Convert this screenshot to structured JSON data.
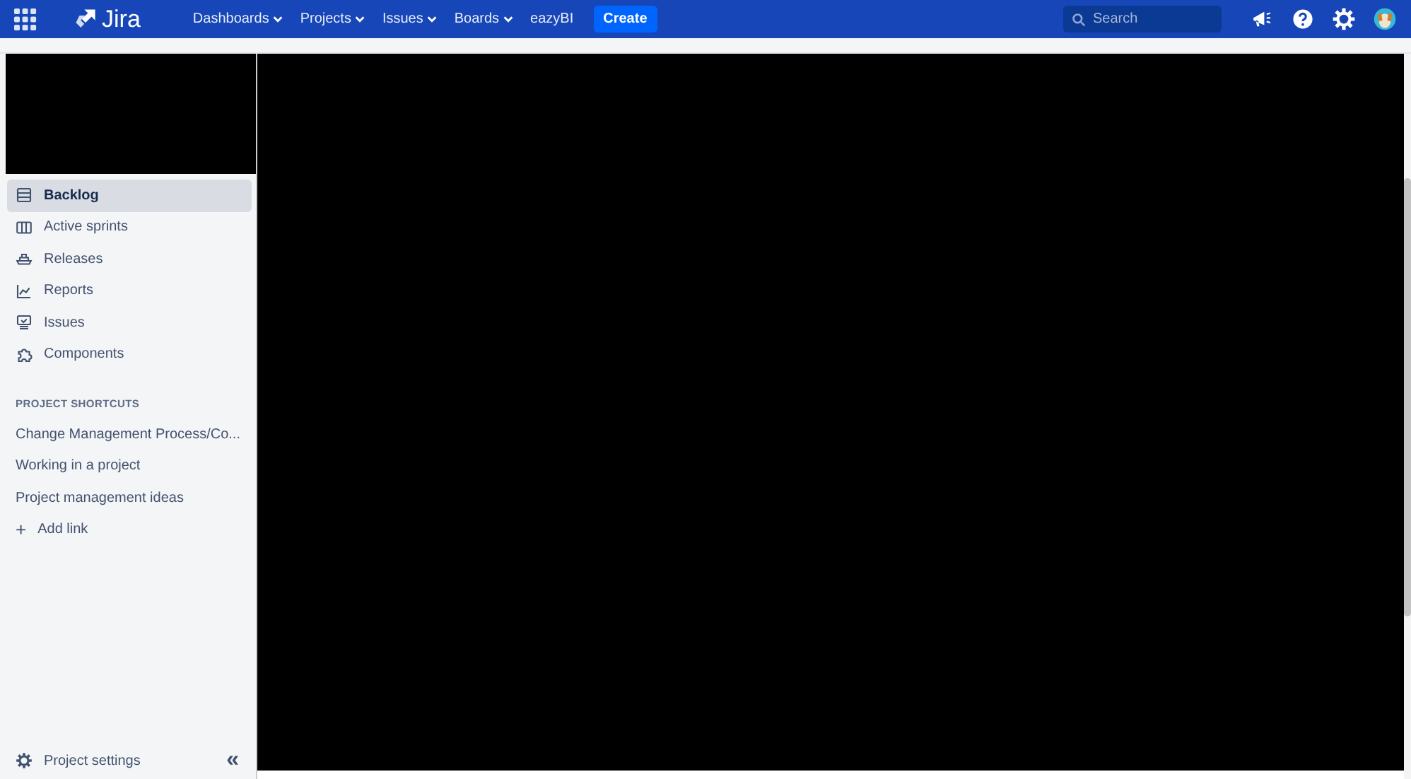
{
  "header": {
    "logo": "Jira",
    "nav": [
      {
        "label": "Dashboards",
        "dropdown": true
      },
      {
        "label": "Projects",
        "dropdown": true
      },
      {
        "label": "Issues",
        "dropdown": true
      },
      {
        "label": "Boards",
        "dropdown": true
      },
      {
        "label": "eazyBI",
        "dropdown": false
      }
    ],
    "create": "Create",
    "search": {
      "placeholder": "Search"
    }
  },
  "sidebar": {
    "items": [
      {
        "label": "Backlog",
        "kind": "backlog",
        "selected": true
      },
      {
        "label": "Active sprints",
        "kind": "board",
        "selected": false
      },
      {
        "label": "Releases",
        "kind": "ship",
        "selected": false
      },
      {
        "label": "Reports",
        "kind": "chart",
        "selected": false
      },
      {
        "label": "Issues",
        "kind": "issues",
        "selected": false
      },
      {
        "label": "Components",
        "kind": "puzzle",
        "selected": false
      }
    ],
    "shortcuts_heading": "PROJECT SHORTCUTS",
    "shortcuts": [
      "Change Management Process/Co...",
      "Working in a project",
      "Project management ideas"
    ],
    "add_link": "Add link",
    "add_icon": "+",
    "settings": "Project settings",
    "collapse": "«"
  }
}
